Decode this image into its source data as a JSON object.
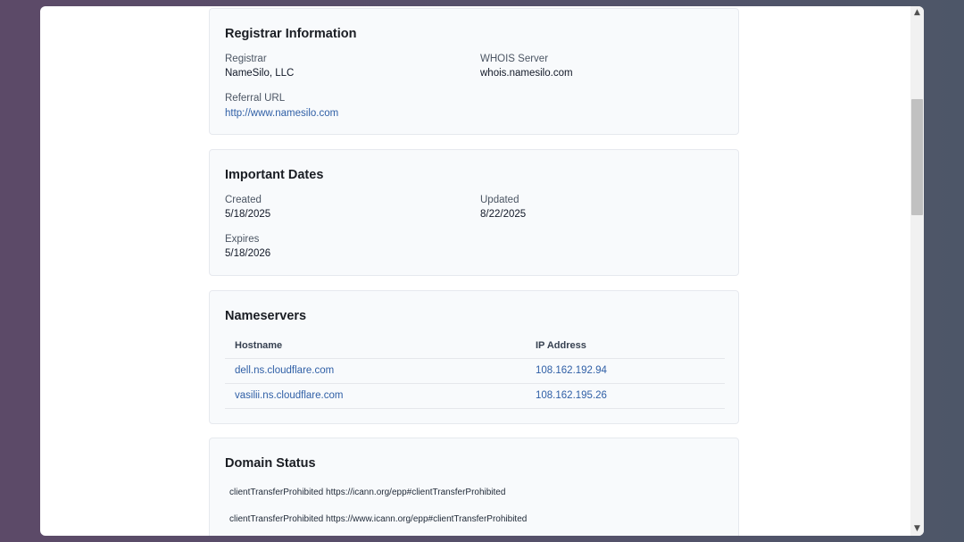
{
  "registrar_card": {
    "title": "Registrar Information",
    "registrar_label": "Registrar",
    "registrar_value": "NameSilo, LLC",
    "whois_label": "WHOIS Server",
    "whois_value": "whois.namesilo.com",
    "referral_label": "Referral URL",
    "referral_value": "http://www.namesilo.com"
  },
  "dates_card": {
    "title": "Important Dates",
    "created_label": "Created",
    "created_value": "5/18/2025",
    "updated_label": "Updated",
    "updated_value": "8/22/2025",
    "expires_label": "Expires",
    "expires_value": "5/18/2026"
  },
  "nameservers_card": {
    "title": "Nameservers",
    "columns": [
      "Hostname",
      "IP Address"
    ],
    "rows": [
      {
        "hostname": "dell.ns.cloudflare.com",
        "ip": "108.162.192.94"
      },
      {
        "hostname": "vasilii.ns.cloudflare.com",
        "ip": "108.162.195.26"
      }
    ]
  },
  "status_card": {
    "title": "Domain Status",
    "items": [
      "clientTransferProhibited https://icann.org/epp#clientTransferProhibited",
      "clientTransferProhibited https://www.icann.org/epp#clientTransferProhibited"
    ]
  },
  "scrollbar": {
    "up_icon": "chevron-up-icon",
    "down_icon": "chevron-down-icon"
  }
}
